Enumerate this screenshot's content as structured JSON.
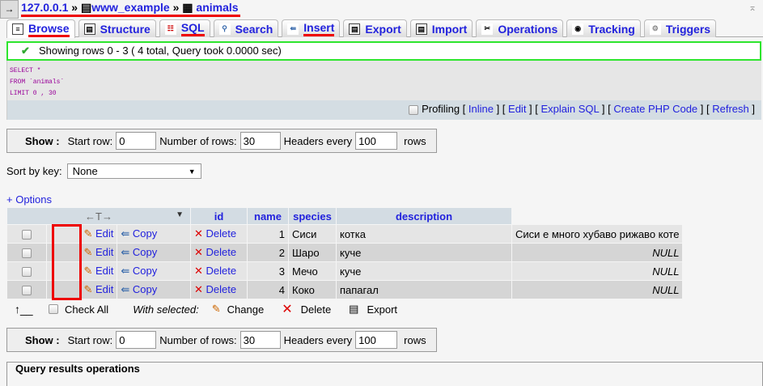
{
  "breadcrumb": {
    "server": "127.0.0.1",
    "database": "www_example",
    "table": "animals",
    "sep": "»"
  },
  "tabs": [
    {
      "label": "Browse",
      "icon": "browse-icon"
    },
    {
      "label": "Structure",
      "icon": "structure-icon"
    },
    {
      "label": "SQL",
      "icon": "sql-icon"
    },
    {
      "label": "Search",
      "icon": "search-icon"
    },
    {
      "label": "Insert",
      "icon": "insert-icon"
    },
    {
      "label": "Export",
      "icon": "export-icon"
    },
    {
      "label": "Import",
      "icon": "import-icon"
    },
    {
      "label": "Operations",
      "icon": "operations-icon"
    },
    {
      "label": "Tracking",
      "icon": "tracking-icon"
    },
    {
      "label": "Triggers",
      "icon": "triggers-icon"
    }
  ],
  "message": "Showing rows 0 - 3 ( 4 total, Query took 0.0000 sec)",
  "sql": {
    "line1": "SELECT *",
    "line2": "FROM `animals`",
    "line3": "LIMIT 0 , 30"
  },
  "sql_links": {
    "profiling": "Profiling",
    "inline": "Inline",
    "edit": "Edit",
    "explain": "Explain SQL",
    "php": "Create PHP Code",
    "refresh": "Refresh"
  },
  "show_form": {
    "show": "Show :",
    "start_row_label": "Start row:",
    "start_row": "0",
    "num_rows_label": "Number of rows:",
    "num_rows": "30",
    "headers_label": "Headers every",
    "headers": "100",
    "rows": "rows"
  },
  "sort": {
    "label": "Sort by key:",
    "value": "None"
  },
  "options": "+ Options",
  "table": {
    "columns": [
      "id",
      "name",
      "species",
      "description"
    ],
    "rows": [
      {
        "id": "1",
        "name": "Сиси",
        "species": "котка",
        "description": "Сиси е много хубаво рижаво коте",
        "null": false
      },
      {
        "id": "2",
        "name": "Шаро",
        "species": "куче",
        "description": "NULL",
        "null": true
      },
      {
        "id": "3",
        "name": "Мечо",
        "species": "куче",
        "description": "NULL",
        "null": true
      },
      {
        "id": "4",
        "name": "Коко",
        "species": "папагал",
        "description": "NULL",
        "null": true
      }
    ],
    "edit": "Edit",
    "copy": "Copy",
    "delete": "Delete"
  },
  "bulk": {
    "check_all": "Check All",
    "with_selected": "With selected:",
    "change": "Change",
    "delete": "Delete",
    "export": "Export"
  },
  "fieldset": "Query results operations"
}
